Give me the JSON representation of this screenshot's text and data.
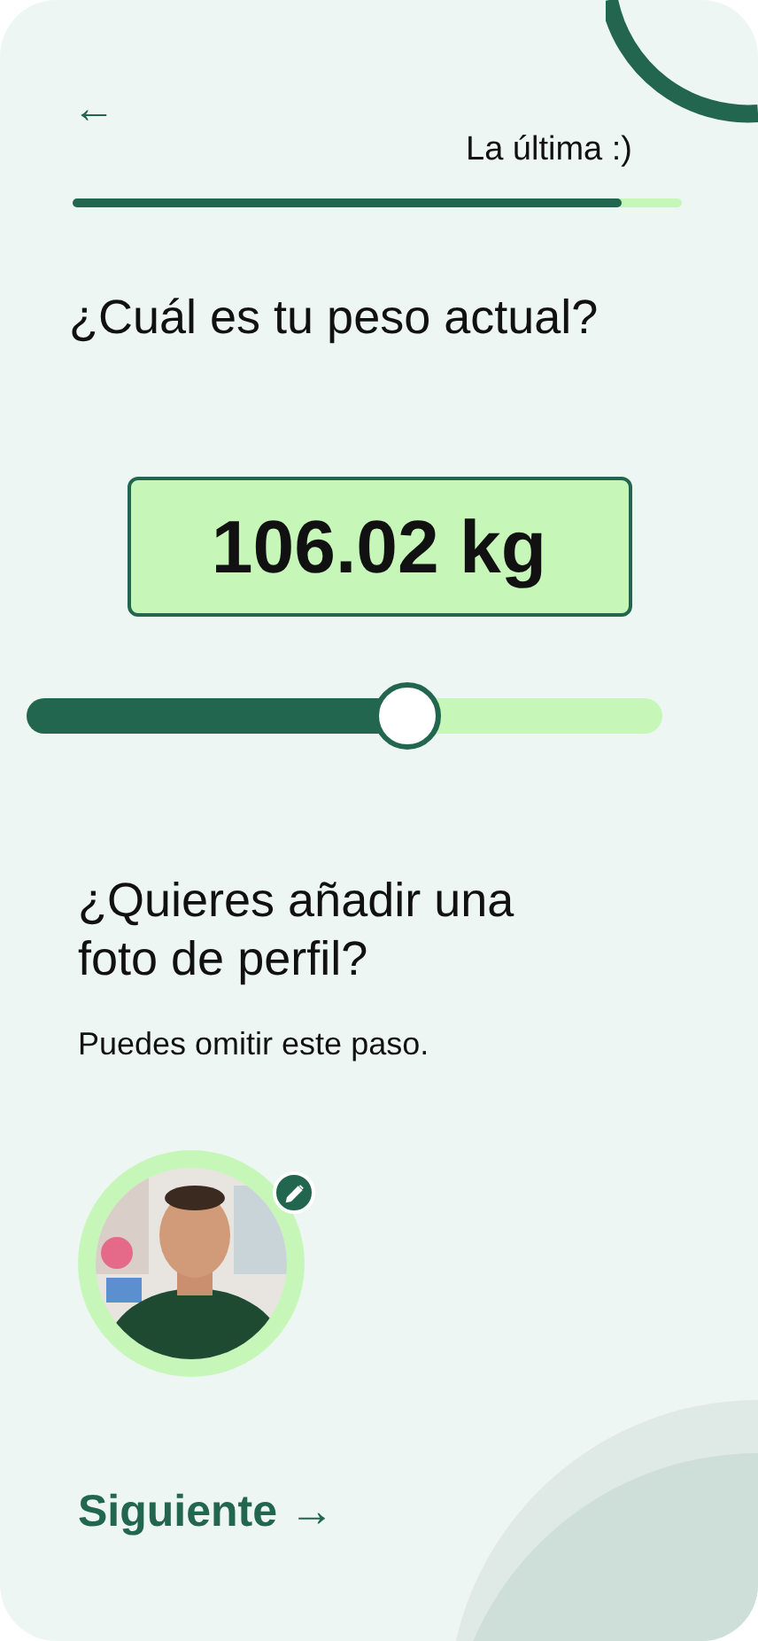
{
  "header": {
    "back_label": "←",
    "step_label": "La última :)",
    "progress": {
      "level": 0.9
    }
  },
  "weight": {
    "question": "¿Cuál es tu peso actual?",
    "value": "106.02 kg",
    "slider": {
      "level": 0.6
    }
  },
  "photo": {
    "question": "¿Quieres añadir una foto de perfil?",
    "hint": "Puedes omitir este paso."
  },
  "next_button": {
    "label": "Siguiente →"
  }
}
